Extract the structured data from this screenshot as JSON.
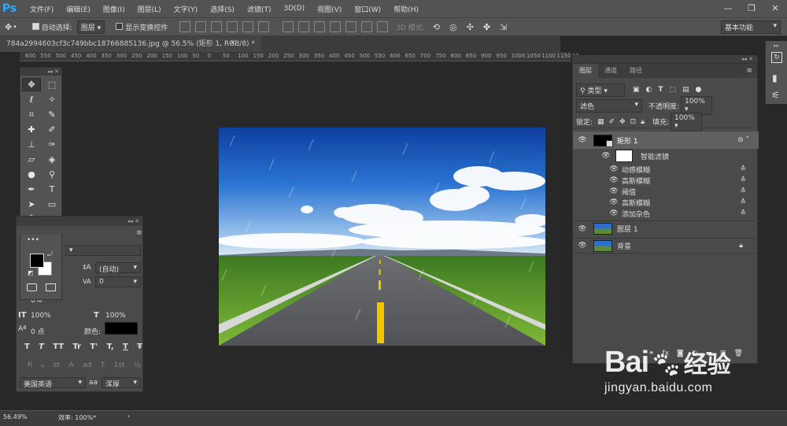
{
  "app": {
    "logo": "Ps"
  },
  "menu": [
    "文件(F)",
    "编辑(E)",
    "图像(I)",
    "图层(L)",
    "文字(Y)",
    "选择(S)",
    "滤镜(T)",
    "3D(D)",
    "视图(V)",
    "窗口(W)",
    "帮助(H)"
  ],
  "window_controls": [
    "—",
    "❐",
    "✕"
  ],
  "options": {
    "auto_select_label": "自动选择:",
    "auto_select_value": "图层",
    "show_transform_label": "显示变换控件",
    "mode3d_label": "3D 模式:",
    "workspace": "基本功能"
  },
  "document": {
    "tab_title": "784a2994603cf3c749bbc18766885136.jpg @ 56.5% (矩形 1, RGB/8) *"
  },
  "ruler": [
    "600",
    "550",
    "500",
    "450",
    "400",
    "350",
    "300",
    "250",
    "200",
    "150",
    "100",
    "50",
    "0",
    "50",
    "100",
    "150",
    "200",
    "250",
    "300",
    "350",
    "400",
    "450",
    "500",
    "550",
    "600",
    "650",
    "700",
    "750",
    "800",
    "850",
    "900",
    "950",
    "1000",
    "1050",
    "1100",
    "1150",
    "12"
  ],
  "character": {
    "leading": "(自动)",
    "tracking_value": "0",
    "percent": "0%",
    "vscale": "100%",
    "hscale": "100%",
    "baseline": "0 点",
    "color_label": "颜色:",
    "language": "美国英语",
    "aa_label": "aa",
    "aa_value": "浑厚",
    "style_buttons": [
      "T",
      "T",
      "TT",
      "Tr",
      "T'",
      "T,",
      "T",
      "Ŧ"
    ],
    "ot_buttons": [
      "fi",
      "ℴ",
      "st",
      "A",
      "ad",
      "T",
      "1st",
      "½"
    ]
  },
  "layers_panel": {
    "tabs": [
      "图层",
      "通道",
      "路径"
    ],
    "filter_type": "类型",
    "blend_mode": "滤色",
    "opacity_label": "不透明度:",
    "opacity_value": "100%",
    "lock_label": "锁定:",
    "fill_label": "填充:",
    "fill_value": "100%",
    "layers": [
      {
        "name": "矩形 1"
      },
      {
        "name": "智能滤镜"
      },
      {
        "name": "动感模糊"
      },
      {
        "name": "高斯模糊"
      },
      {
        "name": "阈值"
      },
      {
        "name": "高斯模糊"
      },
      {
        "name": "添加杂色"
      },
      {
        "name": "图层 1"
      },
      {
        "name": "背景"
      }
    ]
  },
  "status": {
    "zoom": "56.49%",
    "efficiency": "效率: 100%*"
  },
  "watermark": {
    "brand": "Bai",
    "brand_cn": "经验",
    "url": "jingyan.baidu.com"
  },
  "colors": {
    "accent": "#31a8ff",
    "panel": "#535353",
    "background": "#282828"
  }
}
